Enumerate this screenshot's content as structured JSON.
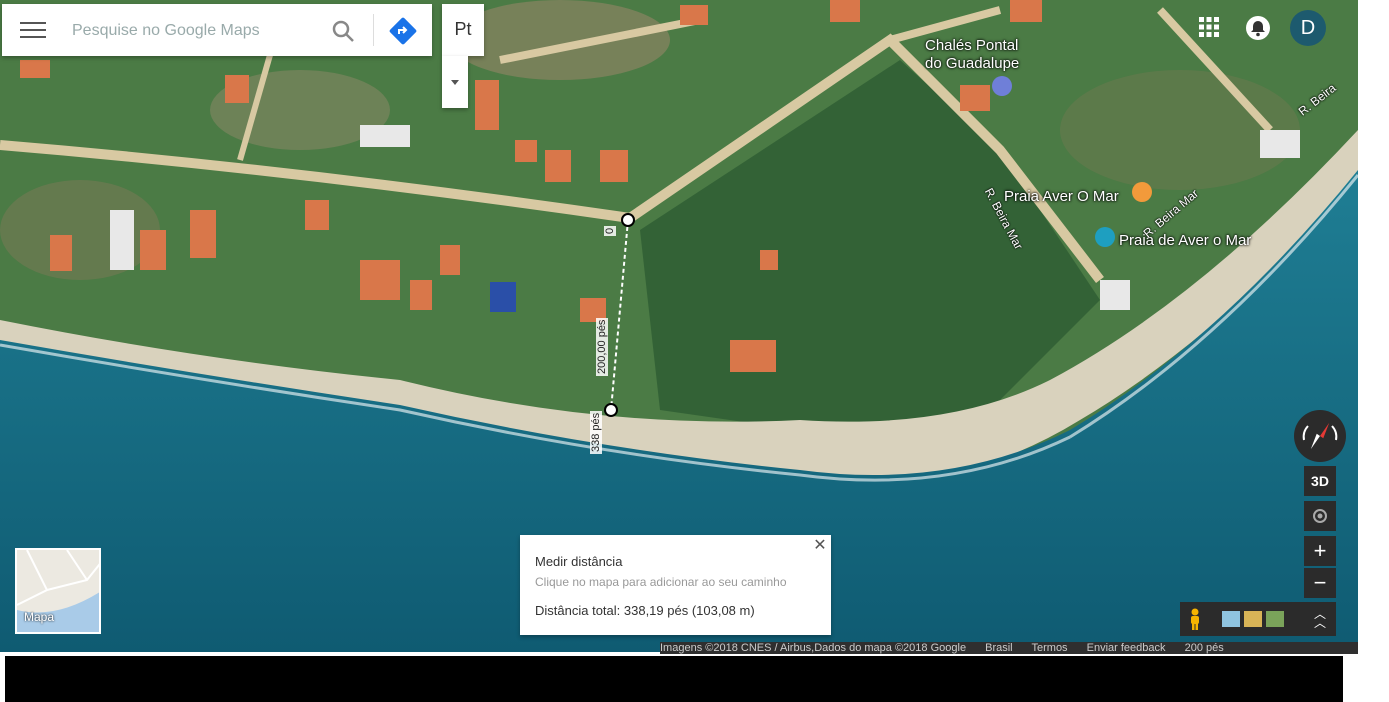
{
  "search": {
    "placeholder": "Pesquise no Google Maps"
  },
  "map_type_box": {
    "label": "Pt"
  },
  "account": {
    "avatar_letter": "D"
  },
  "places": [
    {
      "name": "Chalés Pontal\ndo Guadalupe",
      "line1": "Chalés Pontal",
      "line2": "do Guadalupe",
      "type": "hotel-icon"
    },
    {
      "name": "Praia Aver O Mar",
      "type": "restaurant-icon"
    },
    {
      "name": "Praia de Aver o Mar",
      "type": "camera-icon"
    }
  ],
  "roads": [
    {
      "name": "R. Beira Mar"
    },
    {
      "name": "R. Beira Mar"
    },
    {
      "name": "R. Beira"
    }
  ],
  "measurement": {
    "start_label": "0",
    "mid_label": "200,00 pés",
    "end_label": "338 pés"
  },
  "controls": {
    "three_d": "3D",
    "zoom_in": "+",
    "zoom_out": "−"
  },
  "map_toggle": {
    "label": "Mapa"
  },
  "measure_card": {
    "title": "Medir distância",
    "hint": "Clique no mapa para adicionar ao seu caminho",
    "total": "Distância total: 338,19 pés (103,08 m)"
  },
  "footer": {
    "attribution": "Imagens ©2018 CNES / Airbus,Dados do mapa ©2018 Google",
    "country": "Brasil",
    "terms": "Termos",
    "feedback": "Enviar feedback",
    "scale": "200 pés"
  },
  "colors": {
    "sea": "#1b6f86",
    "vegetation": "#3e7a46",
    "accent": "#1a73e8"
  }
}
